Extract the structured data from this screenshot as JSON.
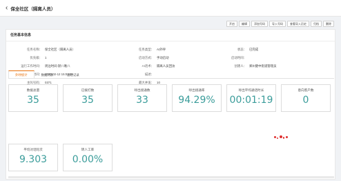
{
  "header": {
    "back_label": "保全社区（隔离人员）"
  },
  "toolbar": {
    "buttons": [
      "开启",
      "编辑",
      "添加号码",
      "导入号码",
      "查看导入历史",
      "归档",
      "删除"
    ]
  },
  "section": {
    "title": "任务基本信息"
  },
  "info": {
    "rows": [
      {
        "l1": "任务名称：",
        "v1": "保全社区（隔离人员）",
        "l2": "任务类型：",
        "v2": "AI外呼",
        "l3": "状态：",
        "v3": "已完成"
      },
      {
        "l1": "优先级：",
        "v1": "1",
        "l2": "启动方式：",
        "v2": "手动启动",
        "l3": "启动时间：",
        "v3": ""
      },
      {
        "l1": "运行工作时间：",
        "v1": "周边时间-默八晚八",
        "l2": "AI话术：",
        "v2": "隔离人员回访",
        "l3": "创建人：",
        "v3": "郑州健中街道管理员"
      },
      {
        "l1": "创建时间：",
        "v1": "2020-02-12 15:04:36",
        "l2": "描述：",
        "v2": "",
        "l3": "",
        "v3": ""
      },
      {
        "l1": "主叫号码：",
        "v1": "0371",
        "l2": "最大并发：",
        "v2": "10",
        "l3": "",
        "v3": ""
      }
    ]
  },
  "tabs": [
    "外呼统计",
    "数据列表",
    "通话记录"
  ],
  "stats": [
    {
      "label": "数据总量",
      "value": "35"
    },
    {
      "label": "已拨打数",
      "value": "35"
    },
    {
      "label": "呼出接通数",
      "value": "33"
    },
    {
      "label": "呼出接通率",
      "value": "94.29%"
    },
    {
      "label": "呼出平均通话时长",
      "value": "00:01:19"
    },
    {
      "label": "意向客户数",
      "value": "0"
    },
    {
      "label": "平均对话轮次",
      "value": "9.303"
    },
    {
      "label": "转人工率",
      "value": "0.00%"
    }
  ],
  "colors": {
    "accent": "#e8700a",
    "stat_value": "#3a9c9a"
  }
}
